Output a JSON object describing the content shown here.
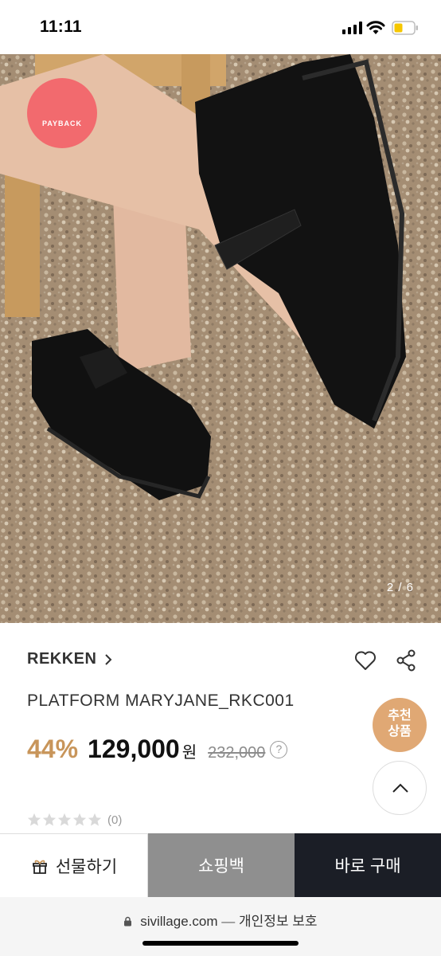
{
  "status_bar": {
    "time": "11:11"
  },
  "hero": {
    "badge_label": "PAYBACK",
    "image_counter": "2 / 6"
  },
  "product": {
    "brand": "REKKEN",
    "name": "PLATFORM MARYJANE_RKC001",
    "discount": "44%",
    "price": "129,000",
    "currency": "원",
    "original_price": "232,000",
    "help_symbol": "?",
    "rating": 0,
    "review_count": "(0)"
  },
  "floating": {
    "recommend_line1": "추천",
    "recommend_line2": "상품"
  },
  "actions": {
    "gift_label": "선물하기",
    "cart_label": "쇼핑백",
    "buy_label": "바로 구매"
  },
  "browser": {
    "domain": "sivillage.com",
    "separator": "—",
    "privacy_label": "개인정보 보호"
  },
  "colors": {
    "discount": "#c8955a",
    "badge": "#f26a6e",
    "recommend": "#e0a874",
    "buy_button": "#1b1e26",
    "cart_button": "#8f8f8f"
  }
}
